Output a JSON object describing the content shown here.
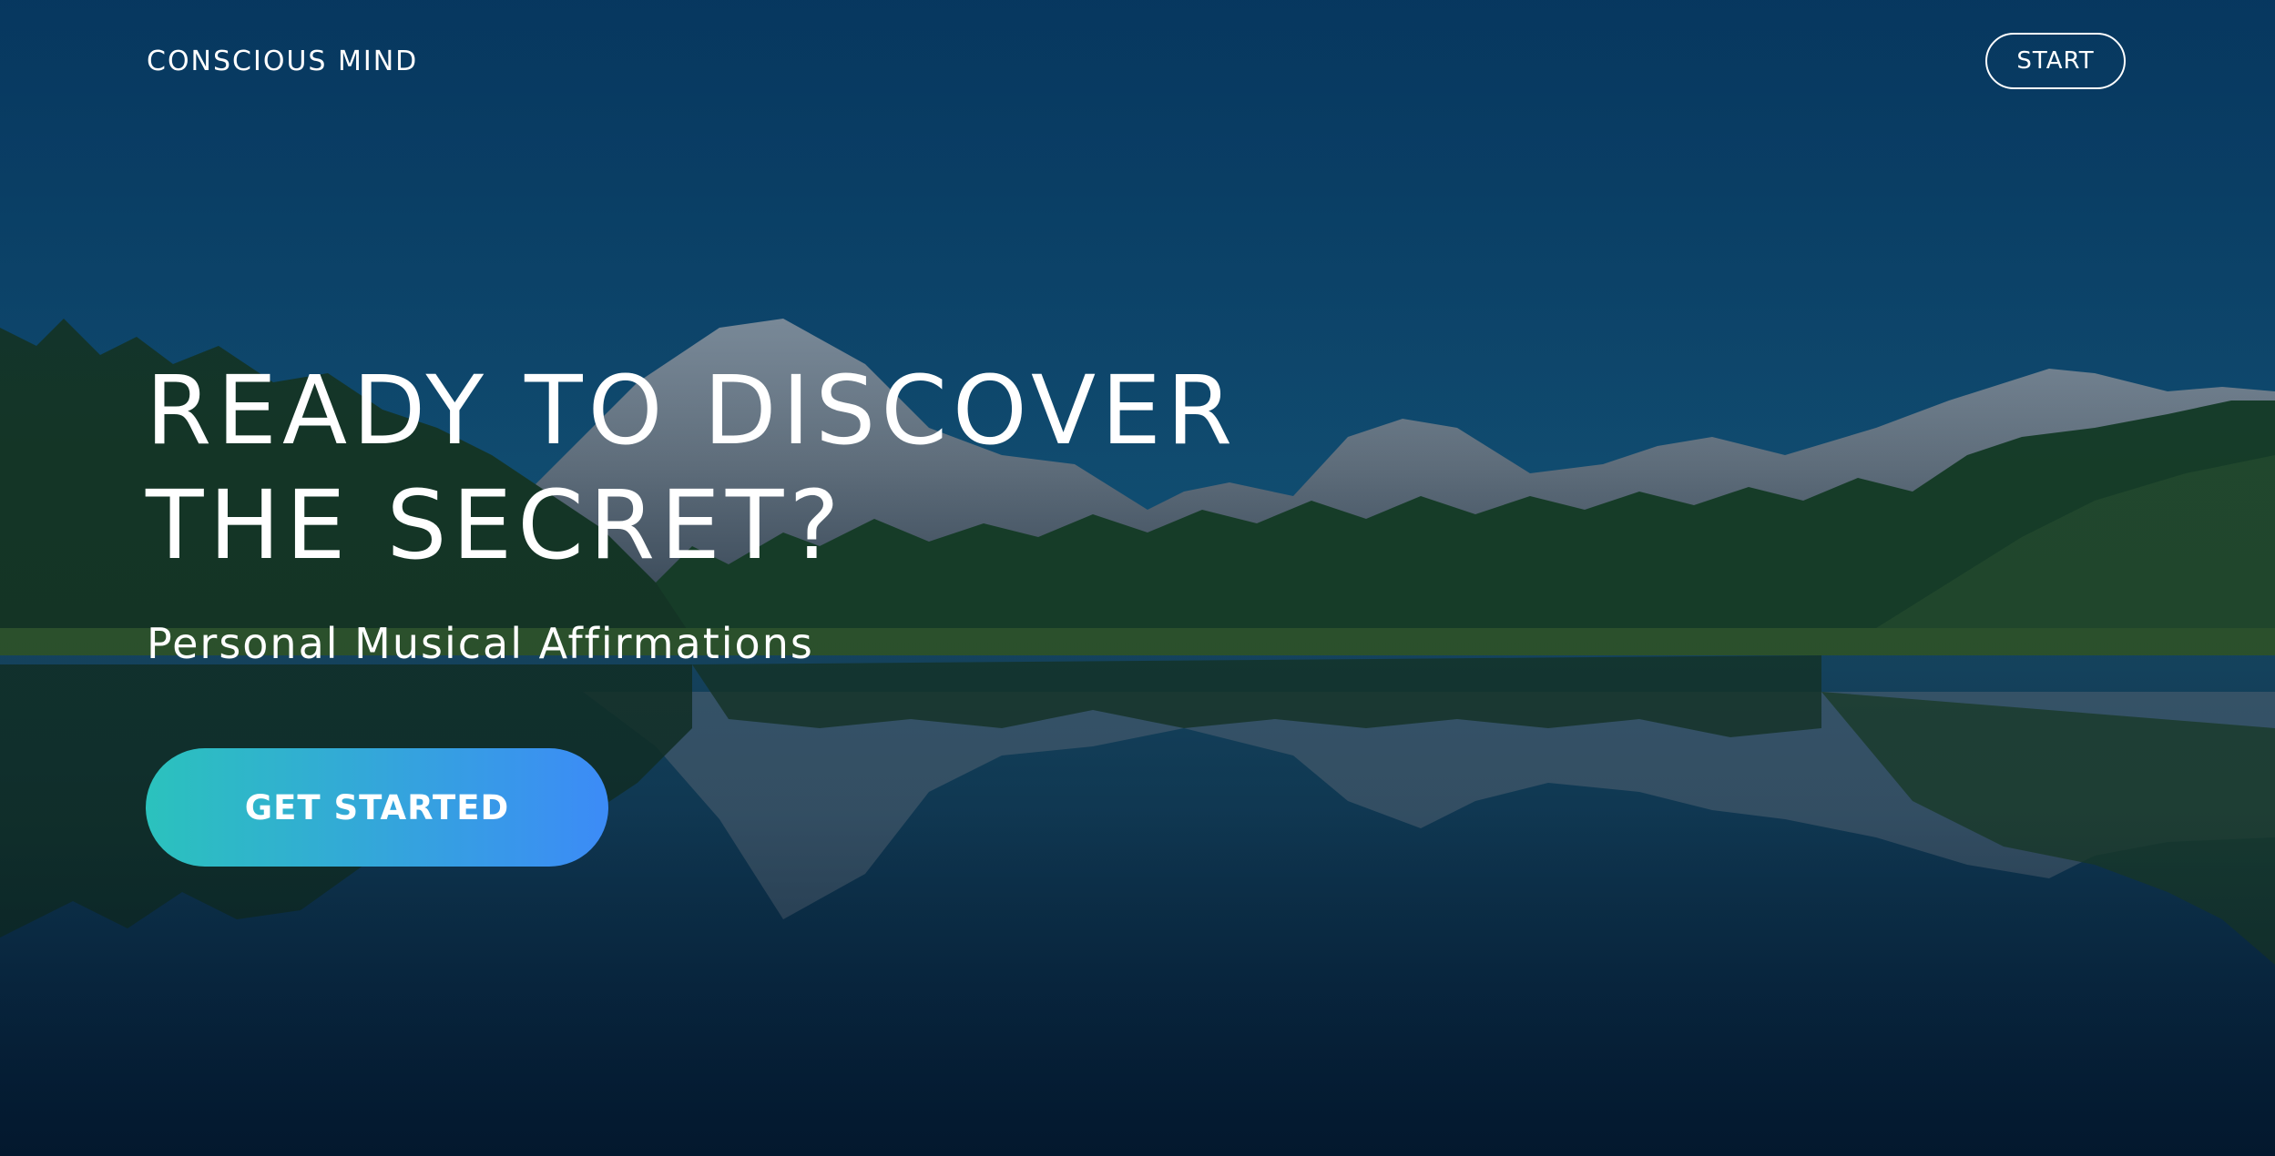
{
  "header": {
    "brand": "CONSCIOUS MIND",
    "start_label": "START"
  },
  "hero": {
    "headline_line1": "READY TO DISCOVER",
    "headline_line2": "THE SECRET?",
    "subtitle": "Personal Musical Affirmations",
    "cta_label": "GET STARTED"
  },
  "colors": {
    "cta_gradient_start": "#2bc2bd",
    "cta_gradient_end": "#3c8bf7",
    "text": "#ffffff"
  }
}
